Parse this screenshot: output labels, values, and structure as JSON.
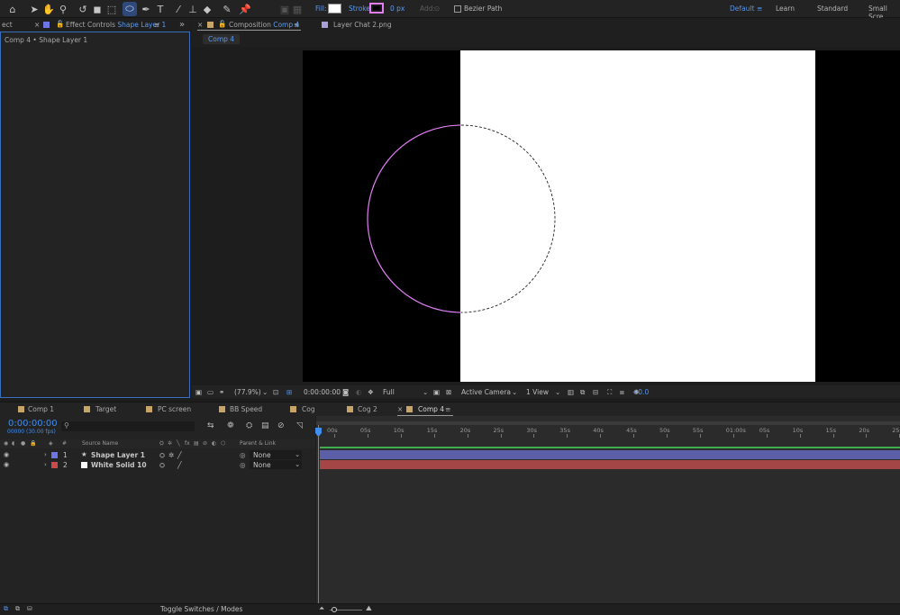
{
  "toolbar": {
    "fill_label": "Fill:",
    "stroke_label": "Stroke:",
    "stroke_width": "0 px",
    "add_label": "Add:",
    "bezier_label": "Bezier Path",
    "workspaces": [
      "Default",
      "Learn",
      "Standard",
      "Small Scre"
    ]
  },
  "left_panel": {
    "partial_tab": "ect",
    "tab_prefix": "Effect Controls",
    "tab_layer": "Shape Layer 1",
    "breadcrumb": "Comp 4 • Shape Layer 1"
  },
  "comp_panel": {
    "tab_prefix": "Composition",
    "tab_name": "Comp 4",
    "other_tab": "Layer Chat 2.png",
    "subtab": "Comp 4"
  },
  "viewer_bar": {
    "zoom": "(77.9%)",
    "timecode": "0:00:00:00",
    "resolution": "Full",
    "camera": "Active Camera",
    "views": "1 View",
    "exposure": "+0.0"
  },
  "timeline_tabs": [
    "Comp 1",
    "Target",
    "PC screen",
    "BB Speed",
    "Cog",
    "Cog 2",
    "Comp 4"
  ],
  "timeline": {
    "current_time": "0:00:00:00",
    "frame_info": "00000 (30.00 fps)",
    "search_placeholder": "",
    "col_num": "#",
    "col_source": "Source Name",
    "col_parent": "Parent & Link",
    "ruler": [
      "00s",
      "05s",
      "10s",
      "15s",
      "20s",
      "25s",
      "30s",
      "35s",
      "40s",
      "45s",
      "50s",
      "55s",
      "01:00s",
      "05s",
      "10s",
      "15s",
      "20s",
      "25s"
    ],
    "layers": [
      {
        "num": "1",
        "name": "Shape Layer 1",
        "parent": "None",
        "color": "#6e76e6",
        "bar": "#5b5fa8"
      },
      {
        "num": "2",
        "name": "White Solid 10",
        "parent": "None",
        "color": "#c84a4a",
        "bar": "#a44646"
      }
    ]
  },
  "status": {
    "toggle_label": "Toggle Switches / Modes"
  },
  "colors": {
    "accent": "#4f96f3",
    "stroke": "#e27ef5",
    "timecode": "#3f8ef0"
  }
}
